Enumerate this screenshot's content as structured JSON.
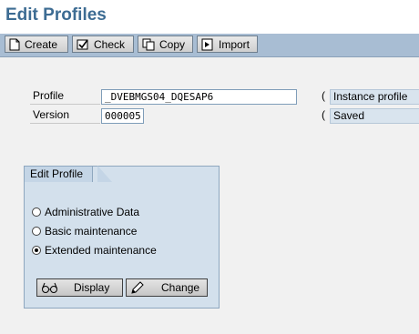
{
  "title": "Edit Profiles",
  "toolbar": {
    "buttons": [
      {
        "label": "Create",
        "icon": "document-icon"
      },
      {
        "label": "Check",
        "icon": "check-icon"
      },
      {
        "label": "Copy",
        "icon": "copy-icon"
      },
      {
        "label": "Import",
        "icon": "import-icon"
      }
    ]
  },
  "form": {
    "profile_label": "Profile",
    "profile_value": "_DVEBMGS04_DQESAP6",
    "profile_type": "Instance profile",
    "version_label": "Version",
    "version_value": "000005",
    "version_status": "Saved"
  },
  "edit_group": {
    "title": "Edit Profile",
    "options": [
      {
        "label": "Administrative Data",
        "selected": false
      },
      {
        "label": "Basic maintenance",
        "selected": false
      },
      {
        "label": "Extended maintenance",
        "selected": true
      }
    ],
    "display_label": "Display",
    "change_label": "Change"
  },
  "colors": {
    "title": "#3d6c93",
    "toolbar": "#a8bdd3",
    "group_bg": "#d3e0ec"
  }
}
